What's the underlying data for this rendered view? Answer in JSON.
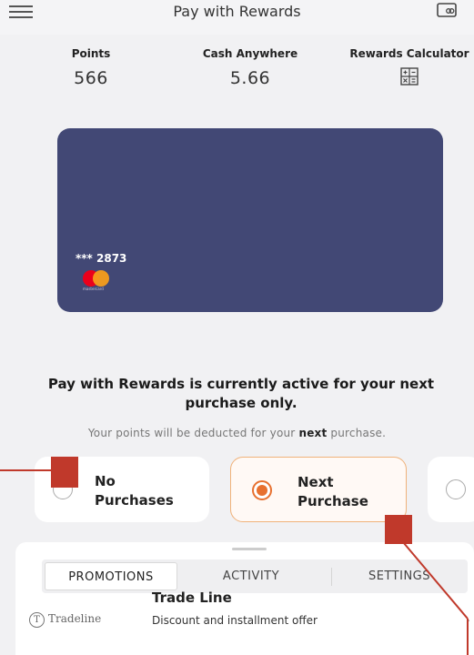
{
  "header": {
    "title": "Pay with Rewards",
    "menu_icon": "hamburger-menu-icon",
    "wallet_icon": "wallet-icon"
  },
  "stats": {
    "points_label": "Points",
    "points_value": "566",
    "cash_label": "Cash Anywhere",
    "cash_value": "5.66",
    "calc_label": "Rewards Calculator",
    "calc_icon": "calculator-icon"
  },
  "card": {
    "number": "*** 2873",
    "brand_text": "mastercard",
    "color": "#424875"
  },
  "message": {
    "headline": "Pay with Rewards is currently active for your next purchase only.",
    "sub_prefix": "Your points will be deducted for your ",
    "sub_bold": "next",
    "sub_suffix": " purchase."
  },
  "options": [
    {
      "label_line1": "No",
      "label_line2": "Purchases",
      "selected": false
    },
    {
      "label_line1": "Next",
      "label_line2": "Purchase",
      "selected": true
    }
  ],
  "accent": "#e7702f",
  "tabs": [
    "PROMOTIONS",
    "ACTIVITY",
    "SETTINGS"
  ],
  "promo": {
    "title": "Trade Line",
    "logo_letter": "T",
    "logo_text": "Tradeline",
    "description": "Discount and installment offer"
  }
}
